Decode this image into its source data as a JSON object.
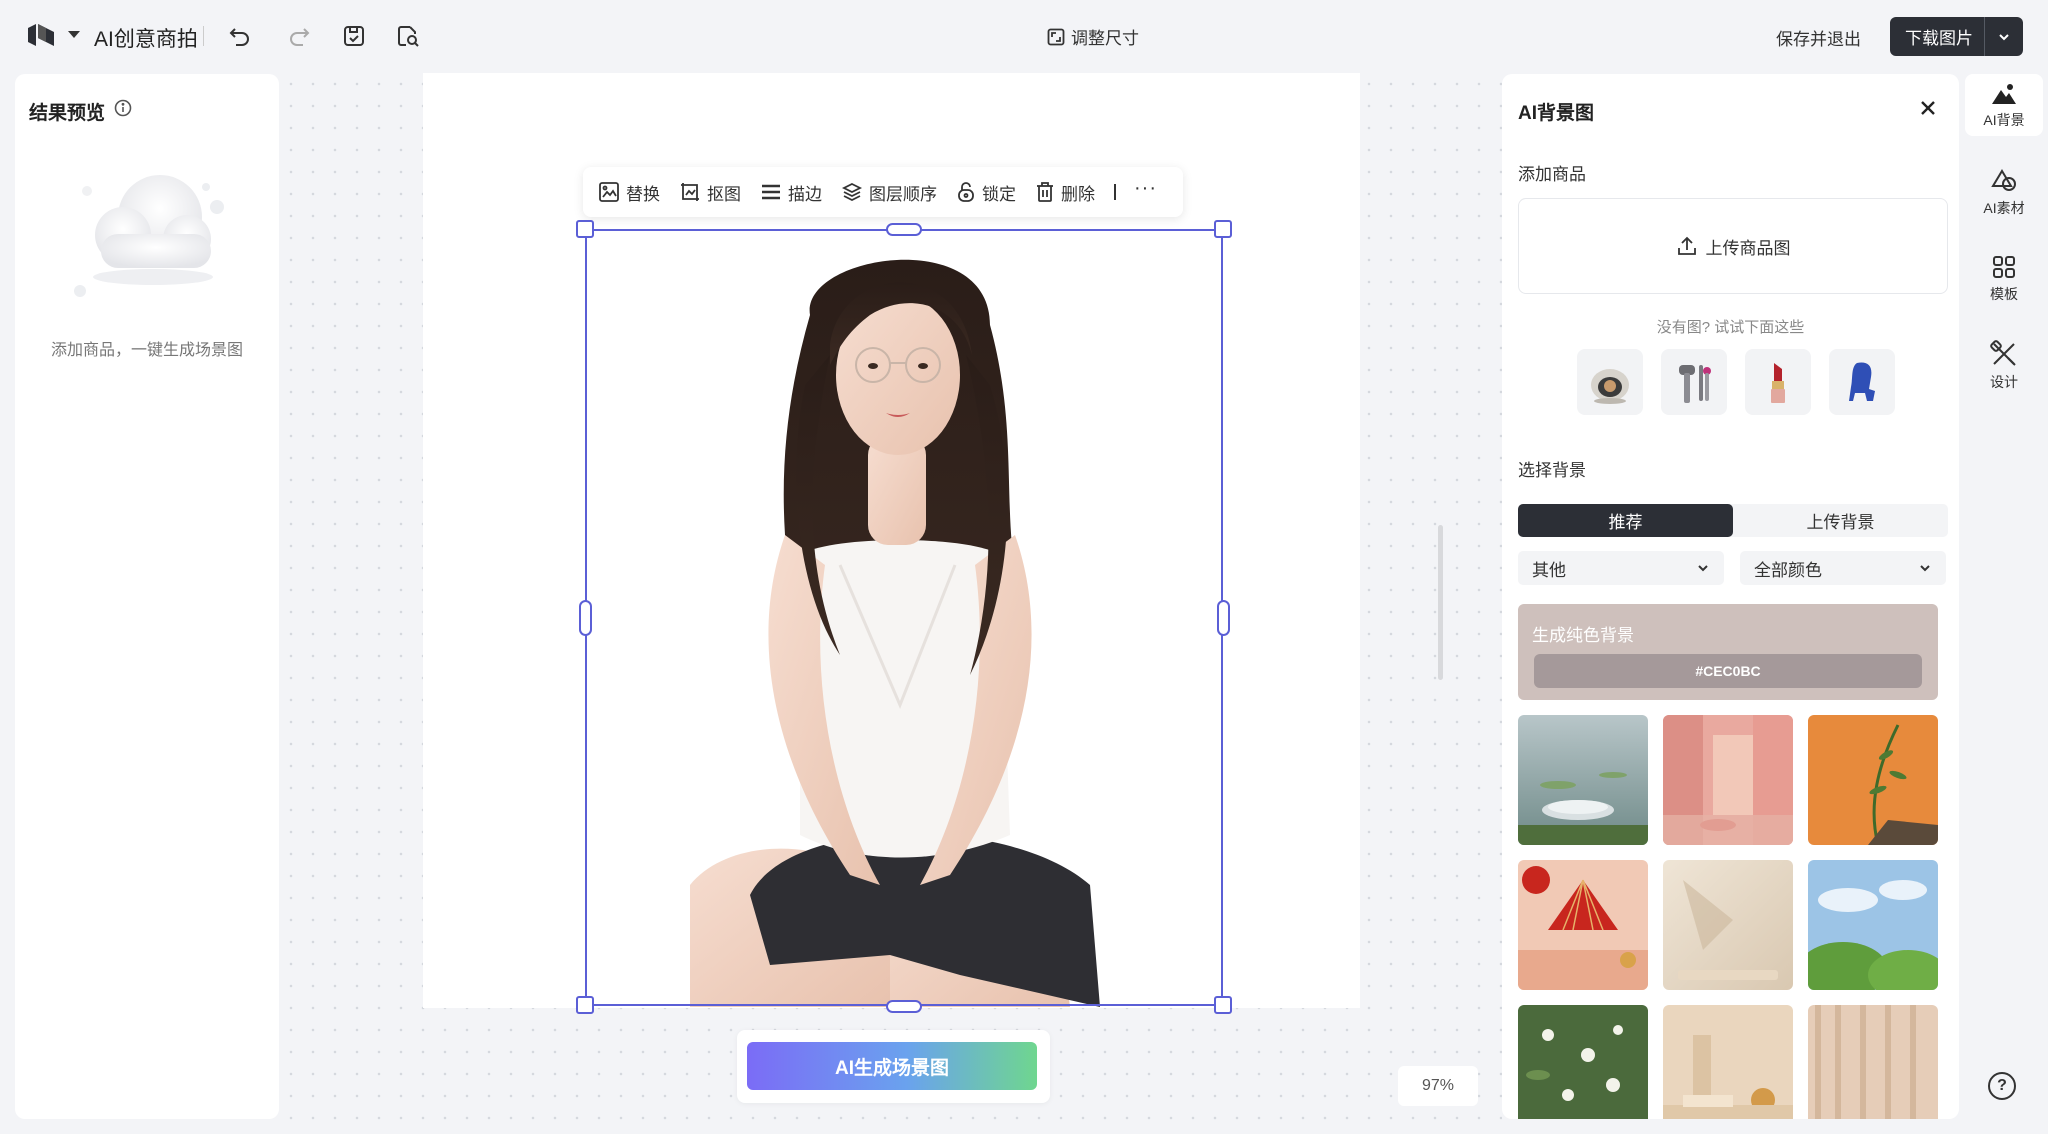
{
  "header": {
    "app_title": "AI创意商拍",
    "resize_label": "调整尺寸",
    "save_exit_label": "保存并退出",
    "download_label": "下载图片"
  },
  "left_panel": {
    "title": "结果预览",
    "hint": "添加商品，一键生成场景图"
  },
  "canvas": {
    "toolbar": {
      "replace": "替换",
      "cutout": "抠图",
      "stroke": "描边",
      "layer_order": "图层顺序",
      "lock": "锁定",
      "delete": "删除",
      "more": "···"
    },
    "generate_button": "AI生成场景图",
    "zoom": "97%"
  },
  "right_panel": {
    "title": "AI背景图",
    "add_product_label": "添加商品",
    "upload_label": "上传商品图",
    "try_hint": "没有图? 试试下面这些",
    "select_bg_label": "选择背景",
    "tabs": [
      {
        "label": "推荐",
        "active": true
      },
      {
        "label": "上传背景",
        "active": false
      }
    ],
    "category_dropdown": "其他",
    "color_dropdown": "全部颜色",
    "solid_bg": {
      "title": "生成纯色背景",
      "hex": "#CEC0BC"
    }
  },
  "rail": {
    "items": [
      {
        "label": "AI背景",
        "icon": "mountain-icon",
        "active": true
      },
      {
        "label": "AI素材",
        "icon": "shapes-icon",
        "active": false
      },
      {
        "label": "模板",
        "icon": "grid-icon",
        "active": false
      },
      {
        "label": "设计",
        "icon": "tools-icon",
        "active": false
      }
    ],
    "help": "?"
  },
  "colors": {
    "accent": "#5b5fd6",
    "dark_button": "#2c2f36",
    "solid_bg": "#cec0bc"
  }
}
